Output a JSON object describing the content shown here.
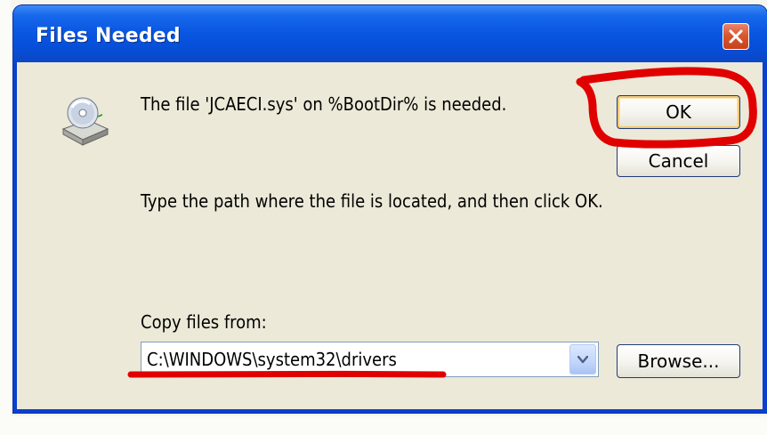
{
  "dialog": {
    "title": "Files Needed",
    "message_file_needed": "The file 'JCAECI.sys' on %BootDir% is needed.",
    "message_instruction": "Type the path where the file is located, and then click OK.",
    "copy_from_label": "Copy files from:",
    "copy_from_value": "C:\\WINDOWS\\system32\\drivers",
    "buttons": {
      "ok": "OK",
      "cancel": "Cancel",
      "browse": "Browse..."
    }
  },
  "icons": {
    "close": "close-icon",
    "disk": "cd-drive-icon",
    "dropdown": "chevron-down-icon"
  },
  "colors": {
    "titlebar": "#0650db",
    "client_bg": "#ece9d8",
    "close_button": "#d9572f",
    "annotation_red": "#e00000"
  }
}
